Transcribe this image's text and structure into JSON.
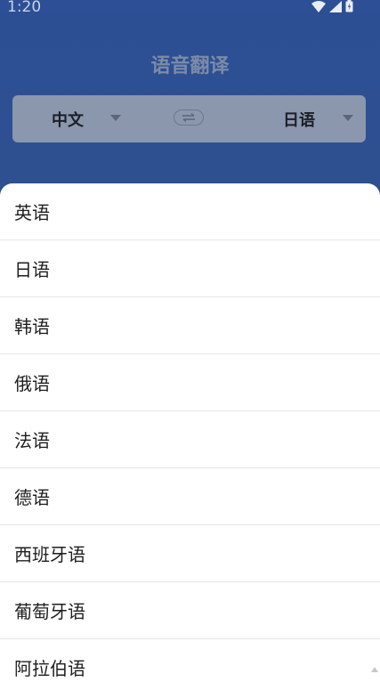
{
  "status_bar": {
    "time": "1:20",
    "icons": [
      "wifi-icon",
      "signal-icon",
      "battery-icon"
    ]
  },
  "header": {
    "title": "语音翻译"
  },
  "language_bar": {
    "source_label": "中文",
    "target_label": "日语",
    "swap_icon": "swap-arrows-icon"
  },
  "language_sheet": {
    "items": [
      {
        "label": "英语"
      },
      {
        "label": "日语"
      },
      {
        "label": "韩语"
      },
      {
        "label": "俄语"
      },
      {
        "label": "法语"
      },
      {
        "label": "德语"
      },
      {
        "label": "西班牙语"
      },
      {
        "label": "葡萄牙语"
      },
      {
        "label": "阿拉伯语"
      }
    ]
  },
  "colors": {
    "header_bg": "#2c4f95",
    "language_bar_bg": "#8a97ad",
    "sheet_bg": "#ffffff",
    "divider": "#e6e6e6"
  }
}
